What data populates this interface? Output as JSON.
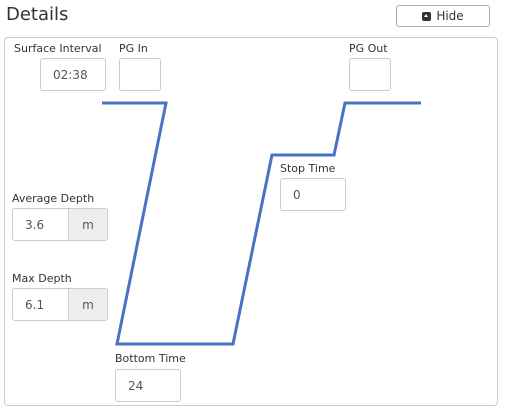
{
  "header": {
    "title": "Details",
    "hide_label": "Hide"
  },
  "fields": {
    "surface_interval": {
      "label": "Surface Interval",
      "value": "02:38"
    },
    "pg_in": {
      "label": "PG In",
      "value": ""
    },
    "pg_out": {
      "label": "PG Out",
      "value": ""
    },
    "stop_time": {
      "label": "Stop Time",
      "value": "0"
    },
    "average_depth": {
      "label": "Average Depth",
      "value": "3.6",
      "unit": "m"
    },
    "max_depth": {
      "label": "Max Depth",
      "value": "6.1",
      "unit": "m"
    },
    "bottom_time": {
      "label": "Bottom Time",
      "value": "24"
    }
  },
  "colors": {
    "profile_line": "#4a72c4"
  }
}
